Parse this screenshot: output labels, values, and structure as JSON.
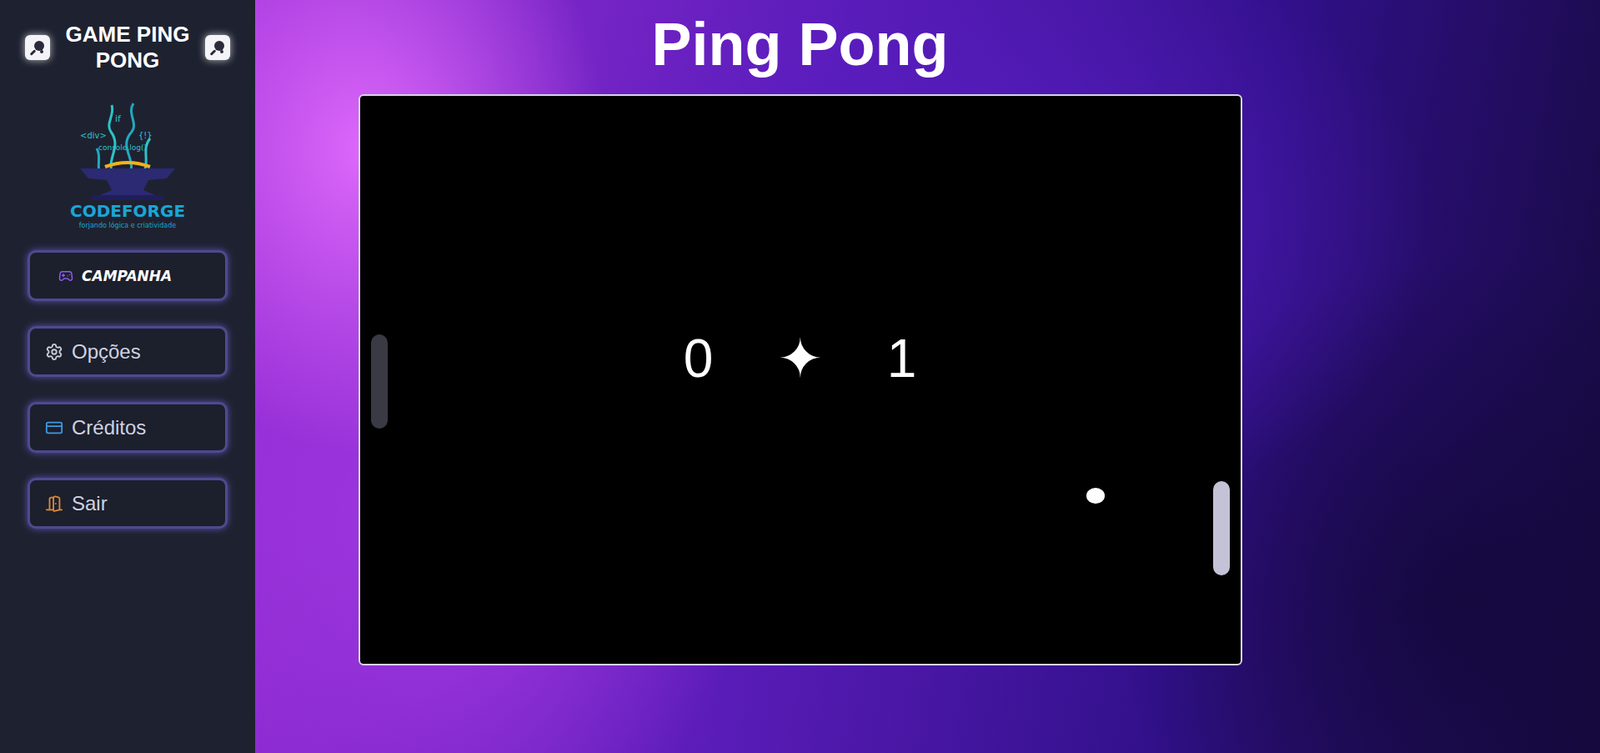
{
  "sidebar": {
    "title": "GAME PING PONG",
    "logo": {
      "name": "CODEFORGE",
      "tagline": "forjando lógica e criatividade",
      "code_words": [
        "if",
        "<div>",
        "{!}",
        "console.log()"
      ]
    },
    "items": [
      {
        "label": "CAMPANHA",
        "kind": "featured"
      },
      {
        "label": "Opções",
        "kind": "normal"
      },
      {
        "label": "Créditos",
        "kind": "normal"
      },
      {
        "label": "Sair",
        "kind": "normal"
      }
    ]
  },
  "game": {
    "title": "Ping Pong",
    "score": {
      "left": "0",
      "separator": "✦",
      "right": "1"
    },
    "paddles": [
      {
        "side": "left",
        "active": false
      },
      {
        "side": "right",
        "active": true
      }
    ]
  }
}
